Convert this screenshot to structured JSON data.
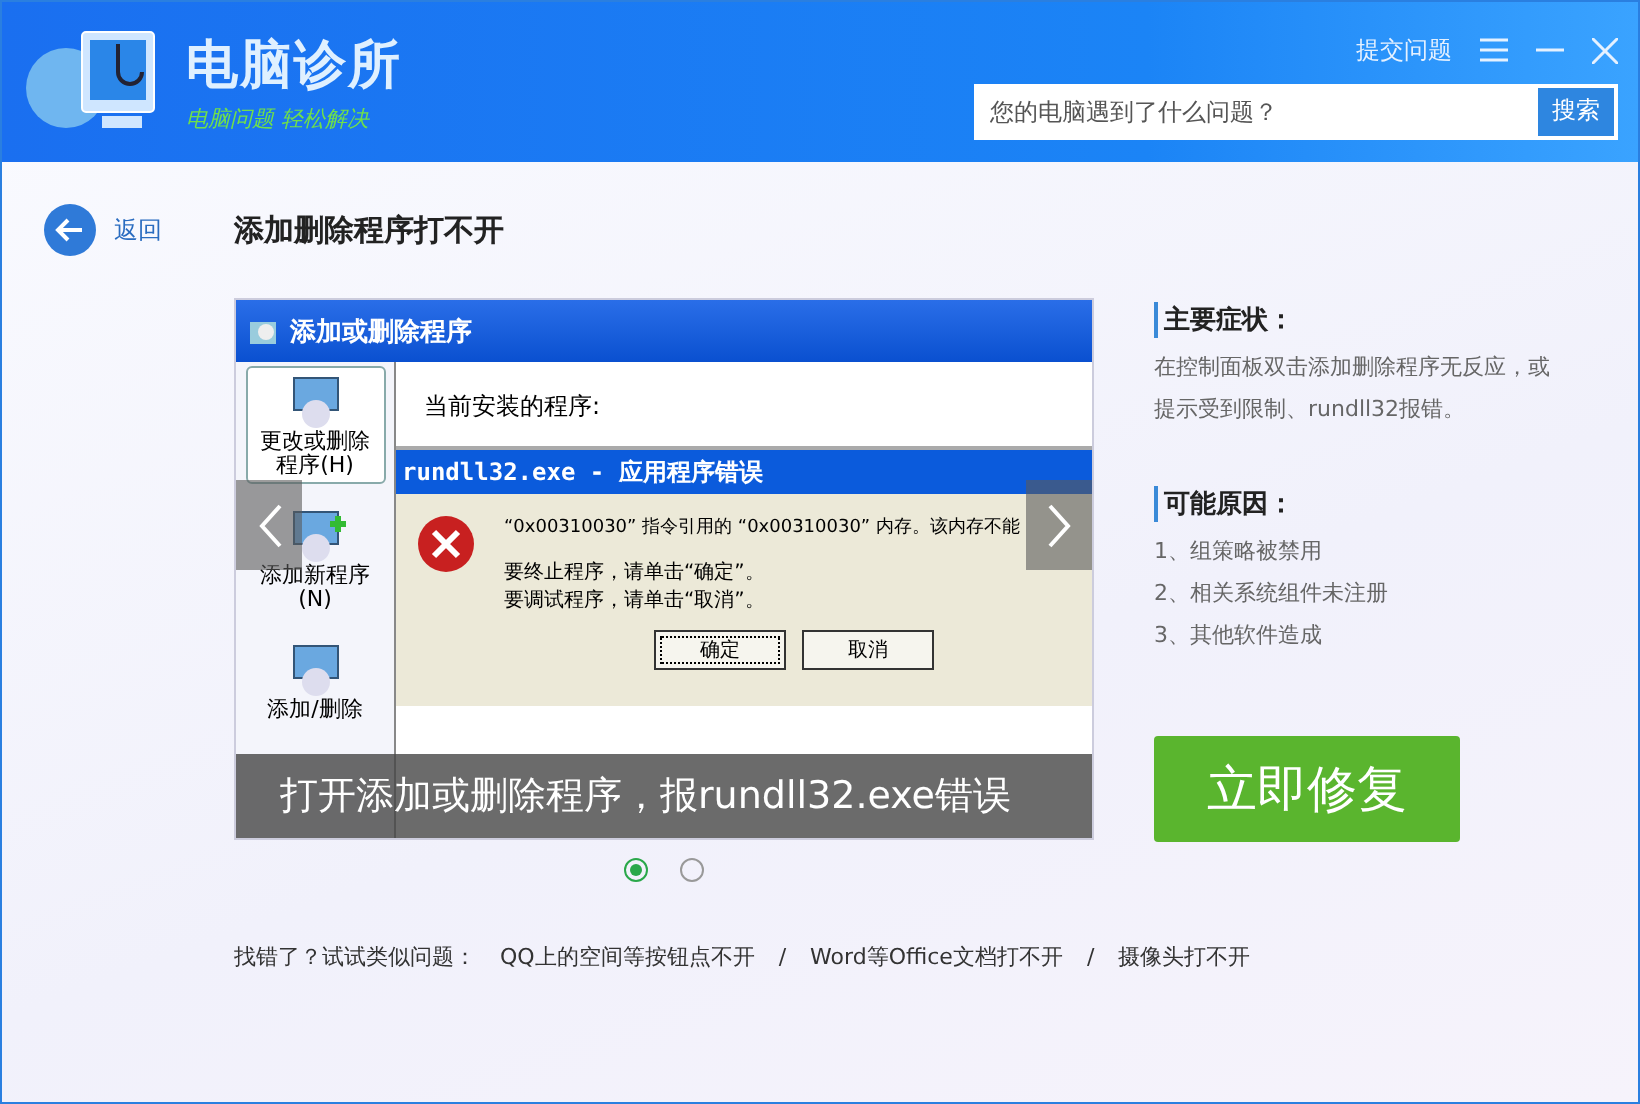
{
  "header": {
    "logo_title": "电脑诊所",
    "logo_subtitle": "电脑问题 轻松解决",
    "submit_link": "提交问题",
    "search": {
      "placeholder": "您的电脑遇到了什么问题？",
      "button": "搜索"
    }
  },
  "page": {
    "back_label": "返回",
    "title": "添加删除程序打不开"
  },
  "slide": {
    "window_title": "添加或删除程序",
    "sidebar": [
      {
        "label": "更改或删除程序(H)",
        "selected": true
      },
      {
        "label": "添加新程序(N)",
        "selected": false
      },
      {
        "label": "添加/删除",
        "selected": false
      }
    ],
    "list_label": "当前安装的程序:",
    "dialog": {
      "title": "rundll32.exe - 应用程序错误",
      "message": "“0x00310030” 指令引用的 “0x00310030” 内存。该内存不能",
      "lines": [
        "要终止程序，请单击“确定”。",
        "要调试程序，请单击“取消”。"
      ],
      "buttons": [
        {
          "label": "确定",
          "selected": true
        },
        {
          "label": "取消",
          "selected": false
        }
      ]
    },
    "caption": "打开添加或删除程序，报rundll32.exe错误"
  },
  "dots": [
    {
      "selected": true
    },
    {
      "selected": false
    }
  ],
  "symptoms": {
    "heading": "主要症状：",
    "text": "在控制面板双击添加删除程序无反应，或提示受到限制、rundll32报错。"
  },
  "causes": {
    "heading": "可能原因：",
    "items": [
      "1、组策略被禁用",
      "2、相关系统组件未注册",
      "3、其他软件造成"
    ]
  },
  "fix_button": "立即修复",
  "suggest": {
    "label": "找错了？试试类似问题：",
    "separator": "/",
    "links": [
      "QQ上的空间等按钮点不开",
      "Word等Office文档打不开",
      "摄像头打不开"
    ]
  }
}
